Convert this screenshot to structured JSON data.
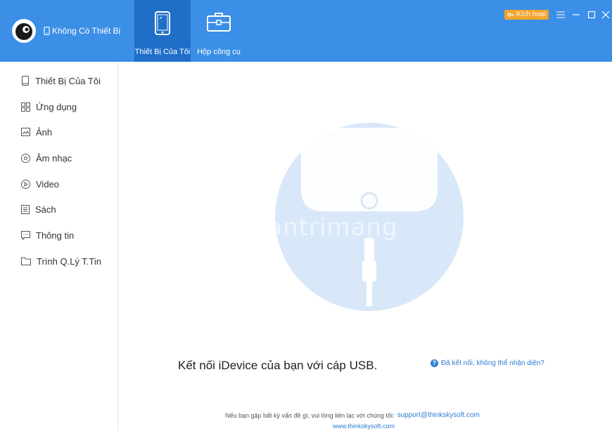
{
  "header": {
    "device_status": "Không Có Thiết Bị",
    "tabs": [
      {
        "label": "Thiết Bị Của Tôi",
        "active": true
      },
      {
        "label": "Hộp công cụ",
        "active": false
      }
    ],
    "activate_label": "Kích hoạt"
  },
  "sidebar": {
    "items": [
      {
        "label": "Thiết Bị Của Tôi",
        "icon": "device-icon"
      },
      {
        "label": "Ứng dụng",
        "icon": "apps-icon"
      },
      {
        "label": "Ảnh",
        "icon": "photo-icon"
      },
      {
        "label": "Âm nhạc",
        "icon": "music-icon"
      },
      {
        "label": "Video",
        "icon": "video-icon"
      },
      {
        "label": "Sách",
        "icon": "book-icon"
      },
      {
        "label": "Thông tin",
        "icon": "message-icon"
      },
      {
        "label": "Trình Q.Lý T.Tin",
        "icon": "folder-icon"
      }
    ]
  },
  "main": {
    "connect_message": "Kết nối iDevice của bạn với cáp USB.",
    "help_link": "Đã kết nối, không thể nhận diện?",
    "contact_text": "Nếu bạn gặp bất kỳ vấn đề gì, vui lòng liên lạc với chúng tôi:",
    "email": "support@thinkskysoft.com",
    "website": "www.thinkskysoft.com",
    "watermark": "Quantrimang"
  },
  "colors": {
    "header_bg": "#3b8fe6",
    "active_tab": "#1f6fc9",
    "accent": "#2d7dd2",
    "activate_bg": "#f2a42c"
  }
}
